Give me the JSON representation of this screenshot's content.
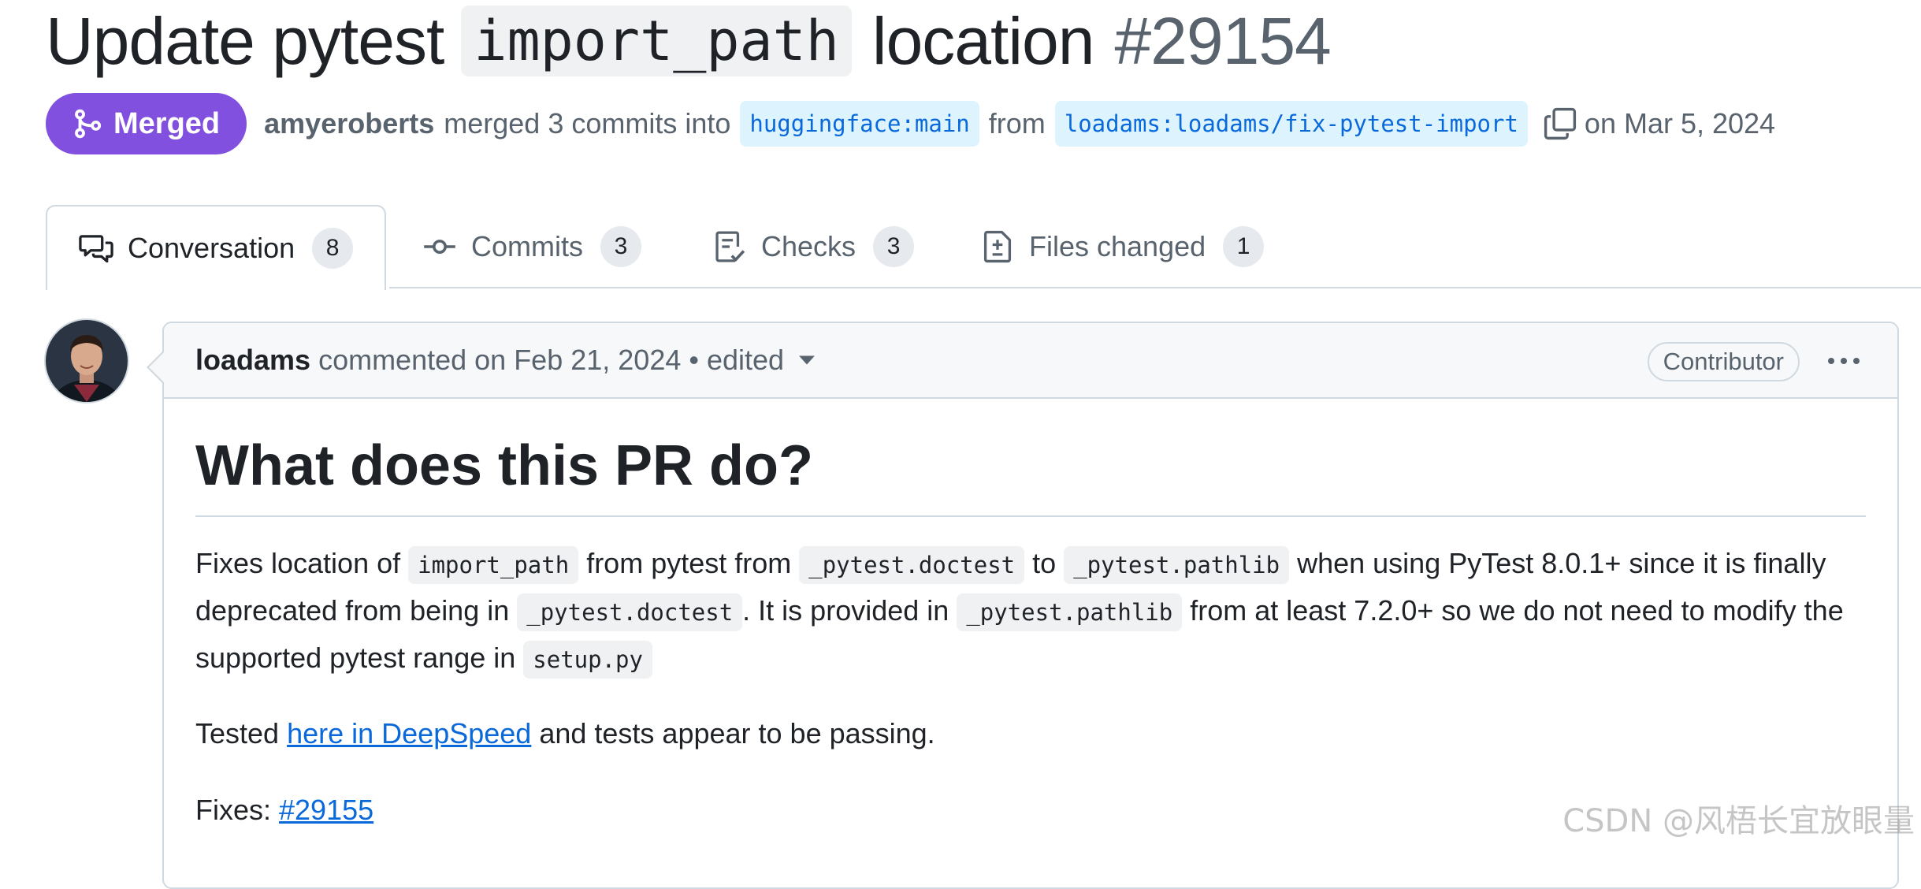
{
  "pr": {
    "title_before": "Update pytest",
    "title_code": "import_path",
    "title_after": "location",
    "number": "#29154"
  },
  "meta": {
    "status": "Merged",
    "author": "amyeroberts",
    "action": "merged 3 commits into",
    "base_branch": "huggingface:main",
    "from_text": "from",
    "head_branch": "loadams:loadams/fix-pytest-import",
    "date": "on Mar 5, 2024"
  },
  "tabs": [
    {
      "label": "Conversation",
      "count": "8",
      "icon": "comment-discussion-icon"
    },
    {
      "label": "Commits",
      "count": "3",
      "icon": "git-commit-icon"
    },
    {
      "label": "Checks",
      "count": "3",
      "icon": "checklist-icon"
    },
    {
      "label": "Files changed",
      "count": "1",
      "icon": "file-diff-icon"
    }
  ],
  "comment": {
    "author": "loadams",
    "action": "commented on Feb 21, 2024",
    "edited": "• edited",
    "badge": "Contributor",
    "heading": "What does this PR do?",
    "p1": {
      "t1": "Fixes location of ",
      "c1": "import_path",
      "t2": " from pytest from ",
      "c2": "_pytest.doctest",
      "t3": " to ",
      "c3": "_pytest.pathlib",
      "t4": " when using PyTest 8.0.1+ since it is finally deprecated from being in ",
      "c4": "_pytest.doctest",
      "t5": ". It is provided in ",
      "c5": "_pytest.pathlib",
      "t6": " from at least 7.2.0+ so we do not need to modify the supported pytest range in ",
      "c6": "setup.py"
    },
    "p2": {
      "t1": "Tested ",
      "link": "here in DeepSpeed",
      "t2": " and tests appear to be passing."
    },
    "p3": {
      "t1": "Fixes: ",
      "link": "#29155"
    }
  },
  "watermark": "CSDN @风梧长宜放眼量",
  "colors": {
    "merged_purple": "#8250df",
    "link_blue": "#0969da",
    "branch_bg": "#ddf4ff",
    "border": "#d1d9e0"
  }
}
